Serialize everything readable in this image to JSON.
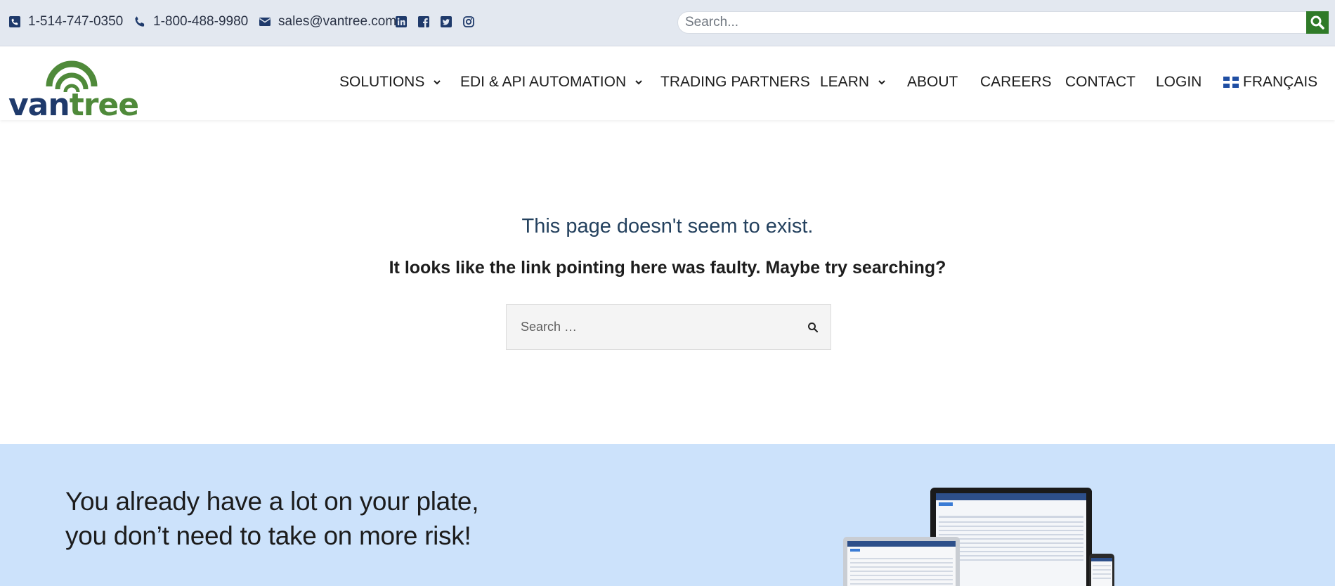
{
  "topbar": {
    "phone_local": "1-514-747-0350",
    "phone_tollfree": "1-800-488-9980",
    "email": "sales@vantree.com",
    "search_placeholder": "Search...",
    "social_icons": [
      "linkedin-icon",
      "facebook-icon",
      "twitter-icon",
      "instagram-icon"
    ]
  },
  "header": {
    "logo_text": "vantree",
    "nav": [
      {
        "label": "SOLUTIONS",
        "has_dropdown": true
      },
      {
        "label": "EDI & API AUTOMATION",
        "has_dropdown": true
      },
      {
        "label": "TRADING PARTNERS",
        "has_dropdown": false
      },
      {
        "label": "LEARN",
        "has_dropdown": true
      },
      {
        "label": "ABOUT",
        "has_dropdown": false
      },
      {
        "label": "CAREERS",
        "has_dropdown": false
      },
      {
        "label": "CONTACT",
        "has_dropdown": false
      },
      {
        "label": "LOGIN",
        "has_dropdown": false
      },
      {
        "label": "FRANÇAIS",
        "has_dropdown": false
      }
    ]
  },
  "main": {
    "title": "This page doesn't seem to exist.",
    "subtitle": "It looks like the link pointing here was faulty. Maybe try searching?",
    "search_placeholder": "Search …"
  },
  "banner": {
    "heading_line1": "You already have a lot on your plate,",
    "heading_line2": "you don’t need to take on more risk!"
  },
  "colors": {
    "brand_navy": "#1f3a6b",
    "brand_green": "#4f8a3a",
    "topbar_bg": "#e3e8f0",
    "banner_bg": "#cce2fb",
    "search_button": "#2f7a28"
  }
}
